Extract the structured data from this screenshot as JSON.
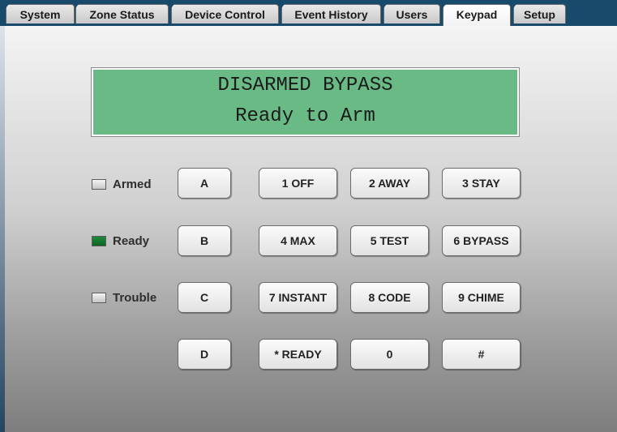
{
  "tabs": [
    {
      "label": "System"
    },
    {
      "label": "Zone Status"
    },
    {
      "label": "Device Control"
    },
    {
      "label": "Event History"
    },
    {
      "label": "Users"
    },
    {
      "label": "Keypad",
      "active": true
    },
    {
      "label": "Setup"
    }
  ],
  "display": {
    "line1": "DISARMED BYPASS",
    "line2": "Ready to Arm",
    "color": "#6aba85"
  },
  "indicators": [
    {
      "label": "Armed",
      "state": "off"
    },
    {
      "label": "Ready",
      "state": "on",
      "color": "#1b7a33"
    },
    {
      "label": "Trouble",
      "state": "off"
    }
  ],
  "function_keys": [
    "A",
    "B",
    "C",
    "D"
  ],
  "keys": [
    [
      "1 OFF",
      "2 AWAY",
      "3 STAY"
    ],
    [
      "4 MAX",
      "5 TEST",
      "6 BYPASS"
    ],
    [
      "7 INSTANT",
      "8 CODE",
      "9 CHIME"
    ],
    [
      "* READY",
      "0",
      "#"
    ]
  ],
  "colors": {
    "tabbar": "#174a6b",
    "lcd": "#6aba85"
  }
}
